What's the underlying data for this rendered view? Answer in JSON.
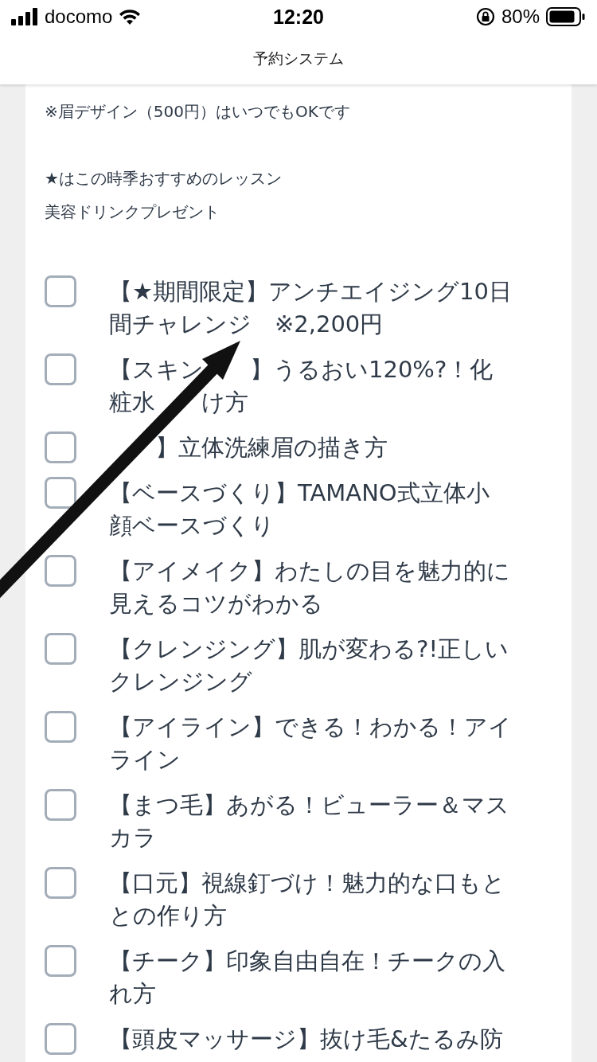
{
  "status_bar": {
    "carrier": "docomo",
    "time": "12:20",
    "battery": "80%"
  },
  "header": {
    "title": "予約システム"
  },
  "notice": "※眉デザイン（500円）はいつでもOKです",
  "recommend_lines": [
    "★はこの時季おすすめのレッスン",
    "美容ドリンクプレゼント"
  ],
  "lessons": [
    {
      "lines": [
        [
          "【★期間限定】アンチエイジング10日"
        ],
        [
          "間チャレンジ　※2,200円"
        ]
      ],
      "checked": false
    },
    {
      "lines": [
        [
          "【スキン",
          "】うるおい120%?！化"
        ],
        [
          "粧水",
          "け方"
        ]
      ],
      "checked": false
    },
    {
      "lines": [
        [
          "】立体洗練眉の描き方"
        ]
      ],
      "covered_start": true,
      "checked": false
    },
    {
      "lines": [
        [
          "【ベースづくり】TAMANO式立体小"
        ],
        [
          "顔ベースづくり"
        ]
      ],
      "checked": false
    },
    {
      "lines": [
        [
          "【アイメイク】わたしの目を魅力的に"
        ],
        [
          "見えるコツがわかる"
        ]
      ],
      "checked": false
    },
    {
      "lines": [
        [
          "【クレンジング】肌が変わる?!正しい"
        ],
        [
          "クレンジング"
        ]
      ],
      "checked": false
    },
    {
      "lines": [
        [
          "【アイライン】できる！わかる！アイ"
        ],
        [
          "ライン"
        ]
      ],
      "checked": false
    },
    {
      "lines": [
        [
          "【まつ毛】あがる！ビューラー＆マス"
        ],
        [
          "カラ"
        ]
      ],
      "checked": false
    },
    {
      "lines": [
        [
          "【口元】視線釘づけ！魅力的な口もと"
        ],
        [
          "との作り方"
        ]
      ],
      "checked": false
    },
    {
      "lines": [
        [
          "【チーク】印象自由自在！チークの入"
        ],
        [
          "れ方"
        ]
      ],
      "checked": false
    },
    {
      "lines": [
        [
          "【頭皮マッサージ】抜け毛&たるみ防"
        ]
      ],
      "checked": false
    }
  ]
}
